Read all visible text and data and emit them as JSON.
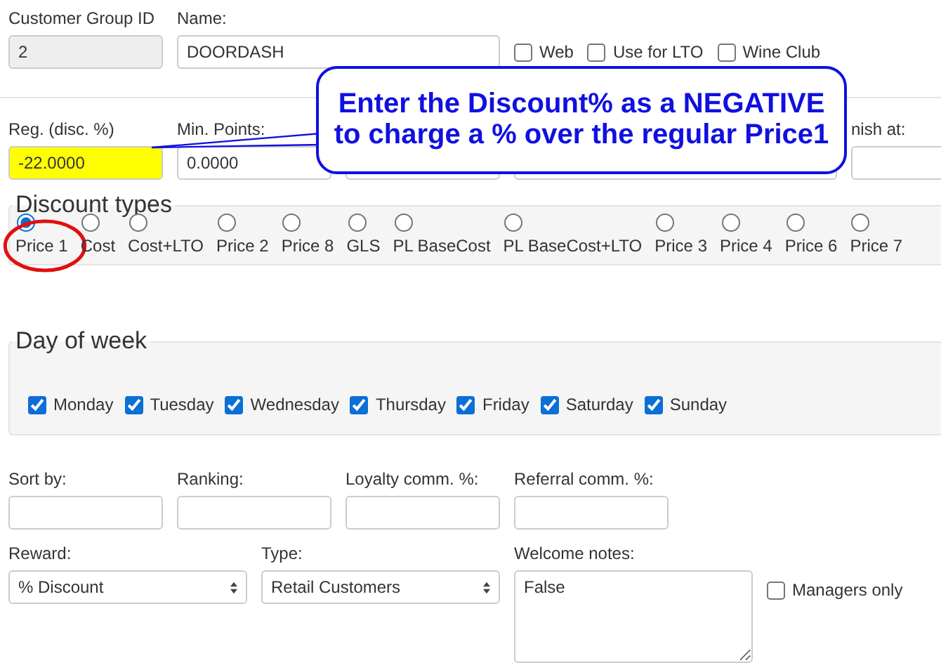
{
  "header_fields": [
    {
      "label": "Customer Group ID",
      "value": "2",
      "disabled": true
    },
    {
      "label": "Name:",
      "value": "DOORDASH",
      "disabled": false
    }
  ],
  "flags": [
    {
      "label": "Web",
      "checked": false
    },
    {
      "label": "Use for LTO",
      "checked": false
    },
    {
      "label": "Wine Club",
      "checked": false
    }
  ],
  "pricing_fields": [
    {
      "label": "Reg. (disc. %)",
      "value": "-22.0000",
      "highlighted": true,
      "wide": false
    },
    {
      "label": "Min. Points:",
      "value": "0.0000",
      "highlighted": false,
      "wide": false
    },
    {
      "highlighted": false,
      "wide": false
    },
    {
      "highlighted": false,
      "wide": true
    },
    {
      "label": "nish at:",
      "highlighted": false,
      "wide": false
    }
  ],
  "callout": {
    "lines": [
      "Enter the Discount% as a NEGATIVE",
      "to charge a % over the regular Price1"
    ]
  },
  "discount_types": {
    "title": "Discount types",
    "options": [
      {
        "label": "Price 1",
        "selected": true,
        "circled": true
      },
      {
        "label": "Cost",
        "selected": false,
        "circled": false
      },
      {
        "label": "Cost+LTO",
        "selected": false,
        "circled": false
      },
      {
        "label": "Price 2",
        "selected": false,
        "circled": false
      },
      {
        "label": "Price 8",
        "selected": false,
        "circled": false
      },
      {
        "label": "GLS",
        "selected": false,
        "circled": false
      },
      {
        "label": "PL BaseCost",
        "selected": false,
        "circled": false
      },
      {
        "label": "PL BaseCost+LTO",
        "selected": false,
        "circled": false
      },
      {
        "label": "Price 3",
        "selected": false,
        "circled": false
      },
      {
        "label": "Price 4",
        "selected": false,
        "circled": false
      },
      {
        "label": "Price 6",
        "selected": false,
        "circled": false
      },
      {
        "label": "Price 7",
        "selected": false,
        "circled": false
      }
    ]
  },
  "day_of_week": {
    "title": "Day of week",
    "days": [
      {
        "label": "Monday",
        "checked": true
      },
      {
        "label": "Tuesday",
        "checked": true
      },
      {
        "label": "Wednesday",
        "checked": true
      },
      {
        "label": "Thursday",
        "checked": true
      },
      {
        "label": "Friday",
        "checked": true
      },
      {
        "label": "Saturday",
        "checked": true
      },
      {
        "label": "Sunday",
        "checked": true
      }
    ]
  },
  "commission_fields": [
    {
      "label": "Sort by:"
    },
    {
      "label": "Ranking:"
    },
    {
      "label": "Loyalty comm. %:"
    },
    {
      "label": "Referral comm. %:"
    }
  ],
  "reward": {
    "label": "Reward:",
    "value": "% Discount"
  },
  "type": {
    "label": "Type:",
    "value": "Retail Customers"
  },
  "welcome_notes": {
    "label": "Welcome notes:",
    "value": "False"
  },
  "managers_only": {
    "label": "Managers only",
    "checked": false
  }
}
